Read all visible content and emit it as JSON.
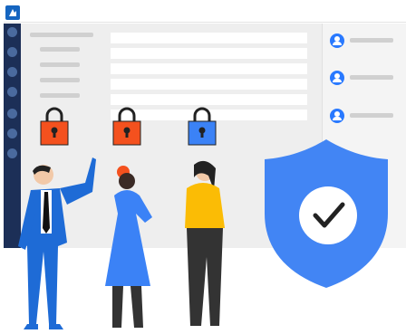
{
  "app": {
    "logo_icon": "brand-logo-icon",
    "brand_color": "#1565c0"
  },
  "colors": {
    "rail": "#1c2f57",
    "accent_blue": "#2979ff",
    "shield": "#4285f4",
    "lock_red": "#f4511e",
    "lock_blue": "#3b82f6",
    "figure_yellow": "#fbbc05"
  },
  "locks": [
    {
      "state": "locked",
      "color": "#f4511e"
    },
    {
      "state": "locked",
      "color": "#f4511e"
    },
    {
      "state": "locked",
      "color": "#3b82f6"
    }
  ],
  "shield": {
    "icon": "shield-check-icon"
  },
  "users": [
    {
      "icon": "user-icon"
    },
    {
      "icon": "user-icon"
    },
    {
      "icon": "user-icon"
    }
  ]
}
